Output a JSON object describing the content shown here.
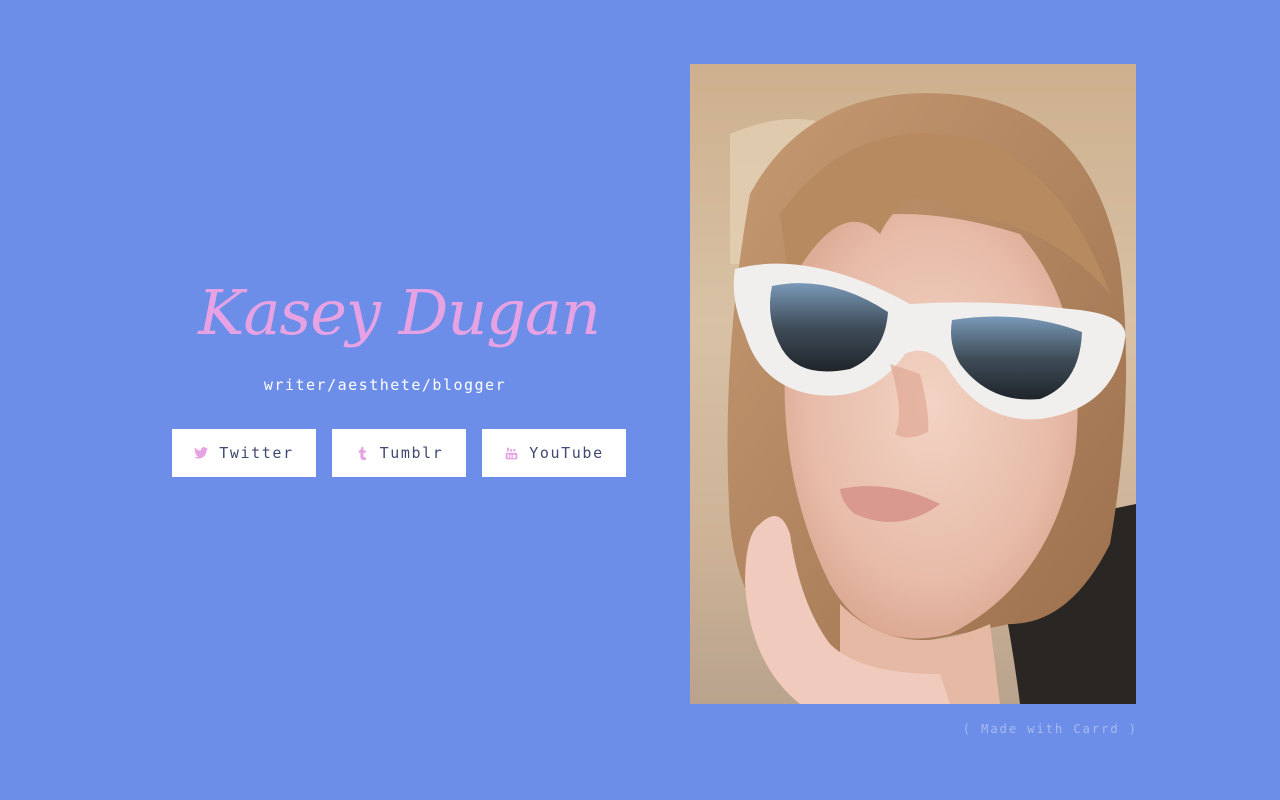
{
  "profile": {
    "name": "Kasey Dugan",
    "tagline": "writer/aesthete/blogger"
  },
  "links": {
    "twitter": {
      "label": "Twitter",
      "icon": "twitter-icon"
    },
    "tumblr": {
      "label": "Tumblr",
      "icon": "tumblr-icon"
    },
    "youtube": {
      "label": "YouTube",
      "icon": "youtube-icon"
    }
  },
  "footer": {
    "credit": "( Made with Carrd )"
  },
  "colors": {
    "background": "#6c8ee8",
    "accent": "#e7a2e3",
    "button_bg": "#ffffff",
    "button_text": "#3f4a72"
  }
}
